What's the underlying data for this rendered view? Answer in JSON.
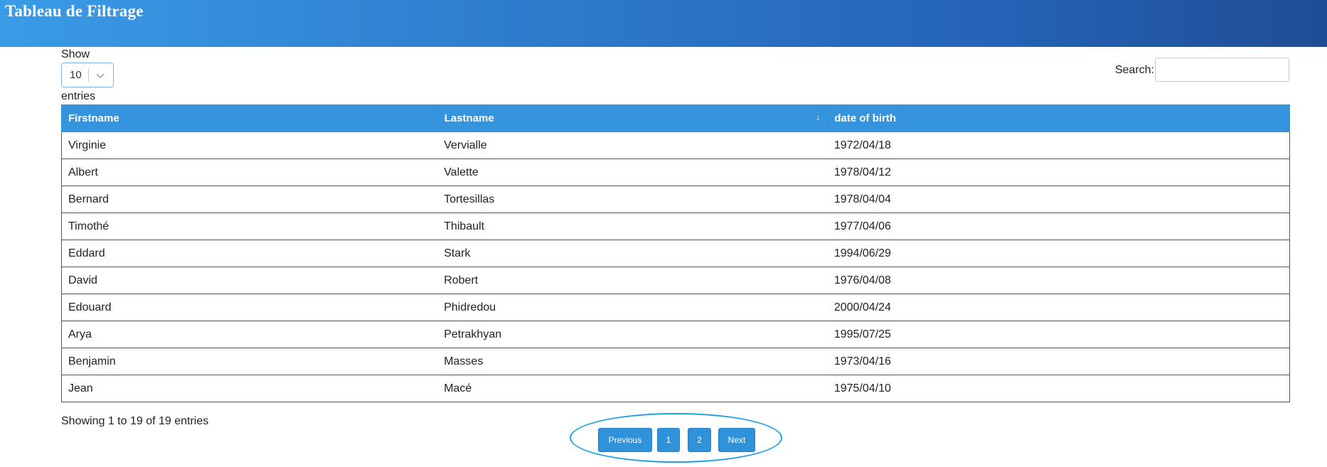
{
  "header": {
    "title": "Tableau de Filtrage"
  },
  "length_menu": {
    "label_before": "Show",
    "selected": "10",
    "label_after": "entries"
  },
  "search": {
    "label": "Search:",
    "value": "",
    "placeholder": ""
  },
  "table": {
    "columns": [
      "Firstname",
      "Lastname",
      "date of birth"
    ],
    "sort_indicator": "↓",
    "rows": [
      [
        "Virginie",
        "Vervialle",
        "1972/04/18"
      ],
      [
        "Albert",
        "Valette",
        "1978/04/12"
      ],
      [
        "Bernard",
        "Tortesillas",
        "1978/04/04"
      ],
      [
        "Timothé",
        "Thibault",
        "1977/04/06"
      ],
      [
        "Eddard",
        "Stark",
        "1994/06/29"
      ],
      [
        "David",
        "Robert",
        "1976/04/08"
      ],
      [
        "Edouard",
        "Phidredou",
        "2000/04/24"
      ],
      [
        "Arya",
        "Petrakhyan",
        "1995/07/25"
      ],
      [
        "Benjamin",
        "Masses",
        "1973/04/16"
      ],
      [
        "Jean",
        "Macé",
        "1975/04/10"
      ]
    ]
  },
  "info": "Showing 1 to 19 of 19 entries",
  "pagination": {
    "previous": "Previous",
    "pages": [
      "1",
      "2"
    ],
    "next": "Next"
  },
  "colors": {
    "header_gradient_start": "#3a9be6",
    "header_gradient_end": "#1f4d95",
    "table_header": "#3495de",
    "button": "#3192dc",
    "highlight_oval": "#1ea0e6"
  }
}
